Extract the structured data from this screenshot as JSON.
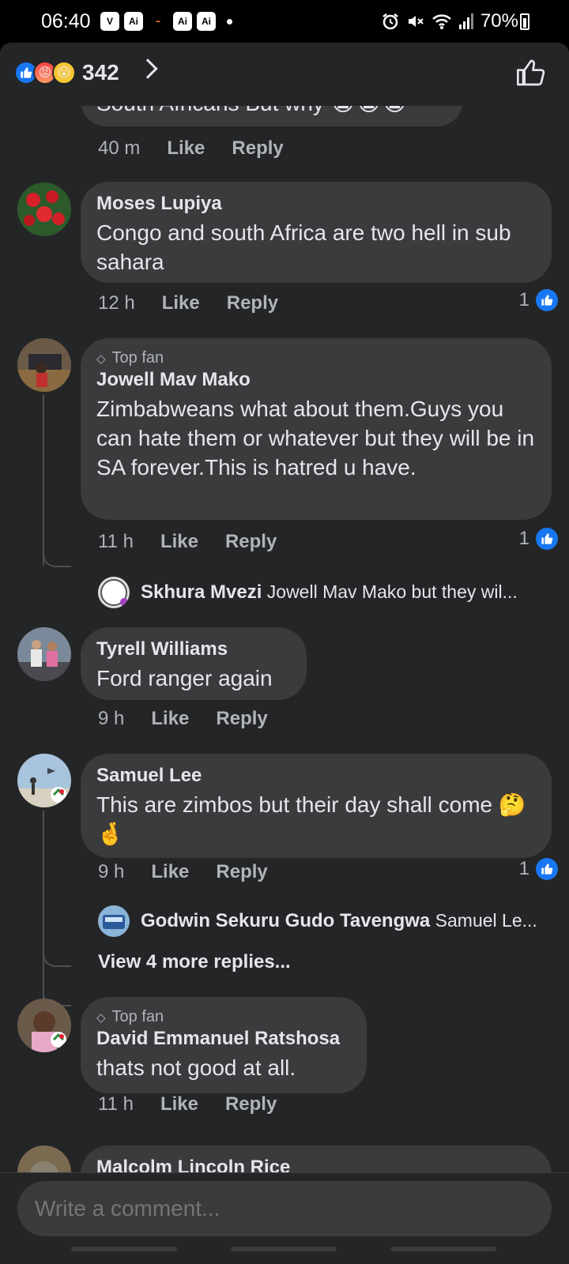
{
  "status_bar": {
    "time": "06:40",
    "app_icons": [
      "V",
      "Ai",
      "Ai",
      "Ai"
    ],
    "battery": "70%"
  },
  "header": {
    "reaction_count": "342"
  },
  "partial_top": {
    "text": "South Africans But why 😭😭😭",
    "time": "40 m",
    "like": "Like",
    "reply": "Reply"
  },
  "comments": [
    {
      "name": "Moses Lupiya",
      "text": "Congo and south Africa are two hell in sub sahara",
      "time": "12 h",
      "like": "Like",
      "reply": "Reply",
      "likes": "1"
    },
    {
      "badge": "Top fan",
      "name": "Jowell Mav Mako",
      "text": "Zimbabweans what about them.Guys you can hate them or whatever but they will be in SA forever.This is hatred u have.",
      "time": "11 h",
      "like": "Like",
      "reply": "Reply",
      "likes": "1",
      "reply_preview": {
        "name": "Skhura Mvezi",
        "text": "Jowell Mav Mako but they wil..."
      }
    },
    {
      "name": "Tyrell Williams",
      "text": "Ford ranger again",
      "time": "9 h",
      "like": "Like",
      "reply": "Reply"
    },
    {
      "name": "Samuel Lee",
      "text": "This are zimbos but their day shall come 🤔🤞",
      "time": "9 h",
      "like": "Like",
      "reply": "Reply",
      "likes": "1",
      "reply_preview": {
        "name": "Godwin Sekuru Gudo Tavengwa",
        "text": "Samuel Le..."
      },
      "more_replies": "View 4 more replies..."
    },
    {
      "badge": "Top fan",
      "name": "David Emmanuel Ratshosa",
      "text": "thats not good at all.",
      "time": "11 h",
      "like": "Like",
      "reply": "Reply"
    },
    {
      "name": "Malcolm Lincoln Rice"
    }
  ],
  "composer": {
    "placeholder": "Write a comment..."
  }
}
